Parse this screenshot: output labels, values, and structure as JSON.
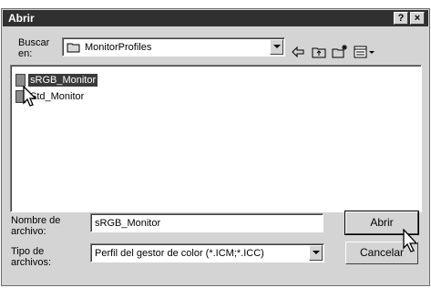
{
  "window": {
    "title": "Abrir",
    "help_label": "?",
    "close_label": "×"
  },
  "lookin": {
    "label_line1": "Buscar",
    "label_line2": "en:",
    "value": "MonitorProfiles"
  },
  "files": [
    {
      "name": "sRGB_Monitor",
      "selected": true
    },
    {
      "name": "Std_Monitor",
      "selected": false
    }
  ],
  "filename": {
    "label_line1": "Nombre de",
    "label_line2": "archivo:",
    "value": "sRGB_Monitor"
  },
  "filetype": {
    "label_line1": "Tipo de",
    "label_line2": "archivos:",
    "value": "Perfil del gestor de color  (*.ICM;*.ICC)"
  },
  "buttons": {
    "open": "Abrir",
    "cancel": "Cancelar"
  },
  "colors": {
    "dialog_bg": "#d4d4d4",
    "titlebar": "#303030",
    "selection": "#3a3a3a"
  },
  "icons": {
    "back": "arrow-left-icon",
    "up": "folder-up-icon",
    "new_folder": "new-folder-icon",
    "view_menu": "view-menu-icon"
  }
}
